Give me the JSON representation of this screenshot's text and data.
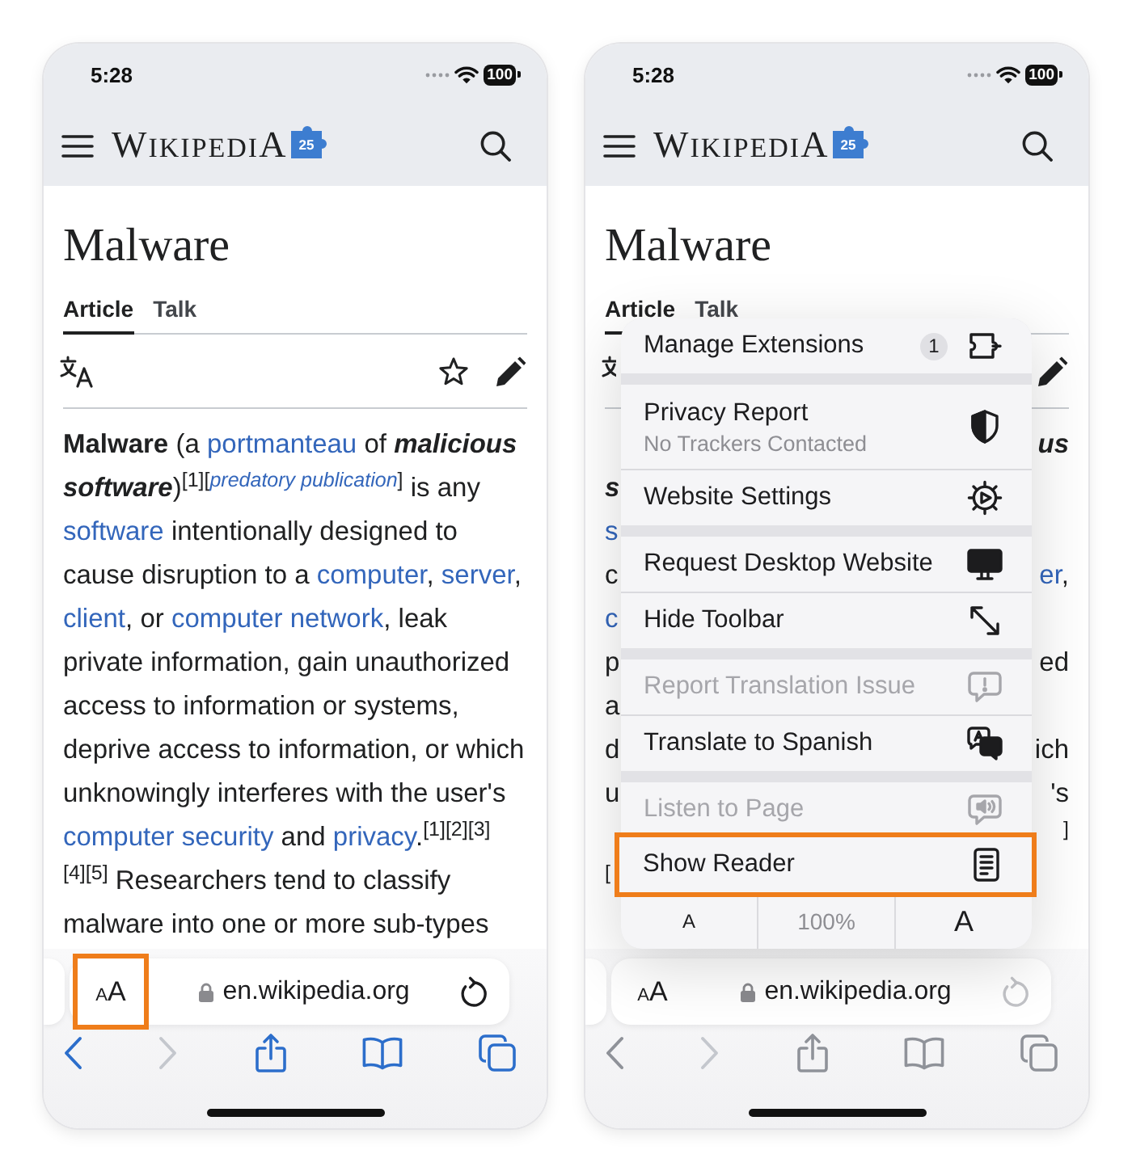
{
  "phones": [
    {
      "status_bar": {
        "time": "5:28",
        "battery": "100"
      },
      "header": {
        "wordmark": "WIKIPEDIA",
        "logo_badge": "25"
      },
      "article": {
        "title": "Malware",
        "tabs": [
          {
            "label": "Article",
            "selected": true
          },
          {
            "label": "Talk",
            "selected": false
          }
        ],
        "paragraph": [
          {
            "text": "Malware",
            "kind": "bold"
          },
          {
            "text": " (a ",
            "kind": "plain"
          },
          {
            "text": "portmanteau",
            "kind": "link"
          },
          {
            "text": " of ",
            "kind": "plain"
          },
          {
            "text": "malicious software",
            "kind": "bold-italic"
          },
          {
            "text": ")",
            "kind": "plain"
          },
          {
            "text": "[1][",
            "kind": "cite"
          },
          {
            "text": "predatory publication",
            "kind": "note-link"
          },
          {
            "text": "]",
            "kind": "cite"
          },
          {
            "text": " is any ",
            "kind": "plain"
          },
          {
            "text": "software",
            "kind": "link"
          },
          {
            "text": " intentionally designed to cause disruption to a ",
            "kind": "plain"
          },
          {
            "text": "computer",
            "kind": "link"
          },
          {
            "text": ", ",
            "kind": "plain"
          },
          {
            "text": "server",
            "kind": "link"
          },
          {
            "text": ", ",
            "kind": "plain"
          },
          {
            "text": "client",
            "kind": "link"
          },
          {
            "text": ", or ",
            "kind": "plain"
          },
          {
            "text": "computer network",
            "kind": "link"
          },
          {
            "text": ", leak private information, gain unauthorized access to information or systems, deprive access to information, or which unknowingly interferes with the user's ",
            "kind": "plain"
          },
          {
            "text": "computer security",
            "kind": "link"
          },
          {
            "text": " and ",
            "kind": "plain"
          },
          {
            "text": "privacy",
            "kind": "link"
          },
          {
            "text": ".",
            "kind": "plain"
          },
          {
            "text": "[1][2][3]",
            "kind": "cite"
          },
          {
            "text": "[4][5]",
            "kind": "cite"
          },
          {
            "text": " Researchers tend to classify malware into one or more sub-types",
            "kind": "plain"
          }
        ]
      },
      "address_bar": {
        "text_size_button": {
          "small": "A",
          "large": "A",
          "highlighted": true
        },
        "url": "en.wikipedia.org"
      },
      "toolbar": [
        {
          "kind": "back",
          "disabled": false
        },
        {
          "kind": "forward",
          "disabled": true
        },
        {
          "kind": "share",
          "disabled": false
        },
        {
          "kind": "bookmarks",
          "disabled": false
        },
        {
          "kind": "tabs",
          "disabled": false
        }
      ],
      "dimmed": false
    },
    {
      "status_bar": {
        "time": "5:28",
        "battery": "100"
      },
      "header": {
        "wordmark": "WIKIPEDIA",
        "logo_badge": "25"
      },
      "article": {
        "title": "Malware",
        "tabs": [
          {
            "label": "Article",
            "selected": true
          },
          {
            "label": "Talk",
            "selected": false
          }
        ],
        "fragment_lines": [
          {
            "right": [
              {
                "text": "us",
                "kind": "bold-italic"
              }
            ]
          },
          {
            "left": [
              {
                "text": "s",
                "kind": "bold-italic"
              }
            ]
          },
          {
            "left": [
              {
                "text": "s",
                "kind": "link"
              }
            ]
          },
          {
            "left": [
              {
                "text": "c",
                "kind": "plain"
              }
            ],
            "right": [
              {
                "text": "er",
                "kind": "link"
              },
              {
                "text": ",",
                "kind": "plain"
              }
            ]
          },
          {
            "left": [
              {
                "text": "c",
                "kind": "link"
              }
            ]
          },
          {
            "left": [
              {
                "text": "p",
                "kind": "plain"
              }
            ],
            "right": [
              {
                "text": "ed",
                "kind": "plain"
              }
            ]
          },
          {
            "left": [
              {
                "text": "a",
                "kind": "plain"
              }
            ]
          },
          {
            "left": [
              {
                "text": "d",
                "kind": "plain"
              }
            ],
            "right": [
              {
                "text": "ich",
                "kind": "plain"
              }
            ]
          },
          {
            "left": [
              {
                "text": "u",
                "kind": "plain"
              }
            ],
            "right": [
              {
                "text": "'s",
                "kind": "plain"
              }
            ]
          },
          {
            "right": [
              {
                "text": "]",
                "kind": "cite"
              }
            ]
          },
          {
            "left": [
              {
                "text": "[",
                "kind": "cite"
              }
            ]
          }
        ]
      },
      "menu": {
        "sections": [
          {
            "items": [
              {
                "label": "Manage Extensions",
                "badge": "1",
                "disabled": false,
                "highlighted": false
              }
            ]
          },
          {
            "items": [
              {
                "label": "Privacy Report",
                "subtitle": "No Trackers Contacted",
                "disabled": false,
                "highlighted": false
              },
              {
                "label": "Website Settings",
                "disabled": false,
                "highlighted": false
              }
            ]
          },
          {
            "items": [
              {
                "label": "Request Desktop Website",
                "disabled": false,
                "highlighted": false
              },
              {
                "label": "Hide Toolbar",
                "disabled": false,
                "highlighted": false
              }
            ]
          },
          {
            "items": [
              {
                "label": "Report Translation Issue",
                "disabled": true,
                "highlighted": false
              },
              {
                "label": "Translate to Spanish",
                "disabled": false,
                "highlighted": false
              }
            ]
          },
          {
            "items": [
              {
                "label": "Listen to Page",
                "disabled": true,
                "highlighted": false
              },
              {
                "label": "Show Reader",
                "disabled": false,
                "highlighted": true
              }
            ]
          }
        ],
        "zoom_controls": [
          {
            "label": "A",
            "kind": "decrease"
          },
          {
            "label": "100%",
            "kind": "level"
          },
          {
            "label": "A",
            "kind": "increase"
          }
        ]
      },
      "address_bar": {
        "text_size_button": {
          "small": "A",
          "large": "A",
          "highlighted": false
        },
        "url": "en.wikipedia.org"
      },
      "toolbar": [
        {
          "kind": "back",
          "disabled": false
        },
        {
          "kind": "forward",
          "disabled": true
        },
        {
          "kind": "share",
          "disabled": false
        },
        {
          "kind": "bookmarks",
          "disabled": false
        },
        {
          "kind": "tabs",
          "disabled": false
        }
      ],
      "dimmed": true
    }
  ]
}
